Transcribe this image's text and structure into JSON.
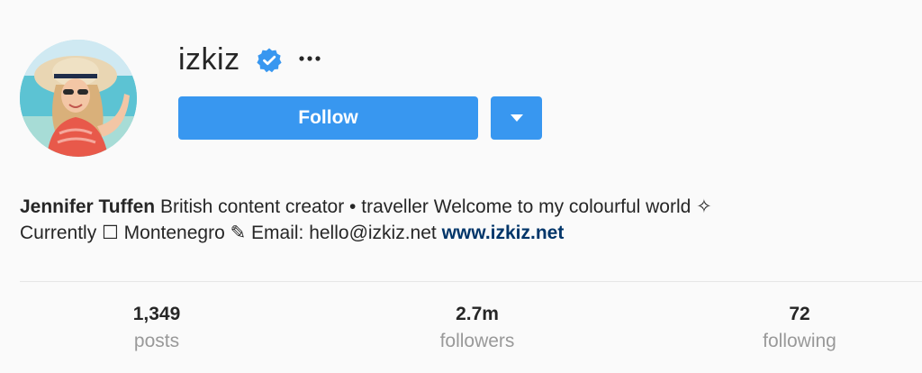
{
  "profile": {
    "username": "izkiz",
    "verified": true,
    "avatar_alt": "profile photo"
  },
  "actions": {
    "follow_label": "Follow",
    "more_icon": "ellipsis-icon",
    "dropdown_icon": "chevron-down-icon"
  },
  "bio": {
    "full_name": "Jennifer Tuffen",
    "line1": " British content creator • traveller Welcome to my colourful world ✧",
    "line2": "Currently ☐ Montenegro ✎ Email: hello@izkiz.net ",
    "website": "www.izkiz.net"
  },
  "stats": [
    {
      "value": "1,349",
      "label": "posts"
    },
    {
      "value": "2.7m",
      "label": "followers"
    },
    {
      "value": "72",
      "label": "following"
    }
  ],
  "colors": {
    "accent": "#3897f0",
    "background": "#fafafa",
    "text": "#262626",
    "muted": "#999999",
    "link": "#003569"
  }
}
